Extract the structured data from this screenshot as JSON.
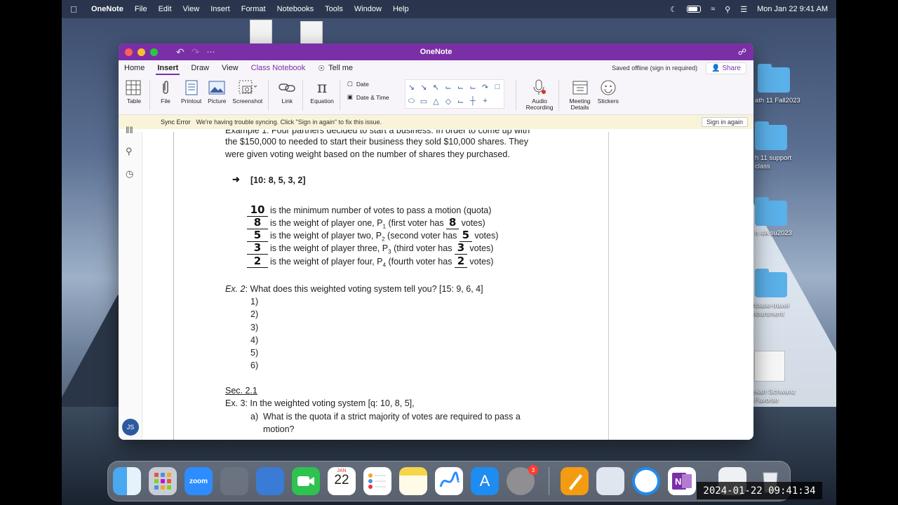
{
  "menubar": {
    "app": "OneNote",
    "items": [
      "File",
      "Edit",
      "View",
      "Insert",
      "Format",
      "Notebooks",
      "Tools",
      "Window",
      "Help"
    ],
    "clock": "Mon Jan 22  9:41 AM"
  },
  "desktop": {
    "items": [
      "ath 11 Fall2023",
      "h 11 support\nclass",
      "h 4A su2023",
      "thbase-travel\nmbursment",
      "ekah Schwanz\n-Favorite"
    ]
  },
  "window": {
    "title": "OneNote",
    "tabs": [
      "Home",
      "Insert",
      "Draw",
      "View",
      "Class Notebook",
      "Tell me"
    ],
    "active_tab": "Insert",
    "saved_status": "Saved offline (sign in required)",
    "share": "Share",
    "ribbon": {
      "table": "Table",
      "file": "File",
      "printout": "Printout",
      "picture": "Picture",
      "screenshot": "Screenshot",
      "link": "Link",
      "equation": "Equation",
      "date": "Date",
      "date_time": "Date & Time",
      "audio": "Audio\nRecording",
      "meeting": "Meeting\nDetails",
      "stickers": "Stickers"
    },
    "sync": {
      "label": "Sync Error",
      "message": "We're having trouble syncing. Click \"Sign in again\" to fix this issue.",
      "button": "Sign in again"
    },
    "avatar": "JS"
  },
  "page": {
    "line0": "Example 1:   Four partners decided to start a business. In order to come up with",
    "line1": "the $150,000 to needed to start their business they sold $10,000 shares. They",
    "line2": "were given voting weight based on the number of shares they purchased.",
    "system": "[10: 8, 5, 3, 2]",
    "rows": [
      {
        "val": "10",
        "pre": "is the minimum number of votes to pass a motion (quota)",
        "post": ""
      },
      {
        "val": "8",
        "pre": "is the weight of player one, P",
        "sub": "1",
        "mid": " (first voter has ",
        "inner": "8",
        "post": " votes)"
      },
      {
        "val": "5",
        "pre": "is the weight of player two, P",
        "sub": "2",
        "mid": " (second voter has ",
        "inner": "5",
        "post": " votes)"
      },
      {
        "val": "3",
        "pre": "is the weight of player three, P",
        "sub": "3",
        "mid": " (third voter has ",
        "inner": "3",
        "post": " votes)"
      },
      {
        "val": "2",
        "pre": "is the weight of player four, P",
        "sub": "4",
        "mid": " (fourth voter has ",
        "inner": "2",
        "post": " votes)"
      }
    ],
    "ex2_label": "Ex. 2",
    "ex2": ":  What does this weighted voting system tell you?    [15: 9, 6, 4]",
    "numbered": [
      "1)",
      "2)",
      "3)",
      "4)",
      "5)",
      "6)"
    ],
    "sec": "Sec. 2.1",
    "ex3": "Ex. 3: In the weighted voting system [q: 10, 8, 5],",
    "ex3a_label": "a)",
    "ex3a": "What is the quota if a strict majority of votes are required to pass a",
    "ex3a_cont": "motion?"
  },
  "dock": {
    "calendar_month": "JAN",
    "calendar_day": "22",
    "settings_badge": "3",
    "zoom": "zoom"
  },
  "timestamp": "2024-01-22  09:41:34"
}
